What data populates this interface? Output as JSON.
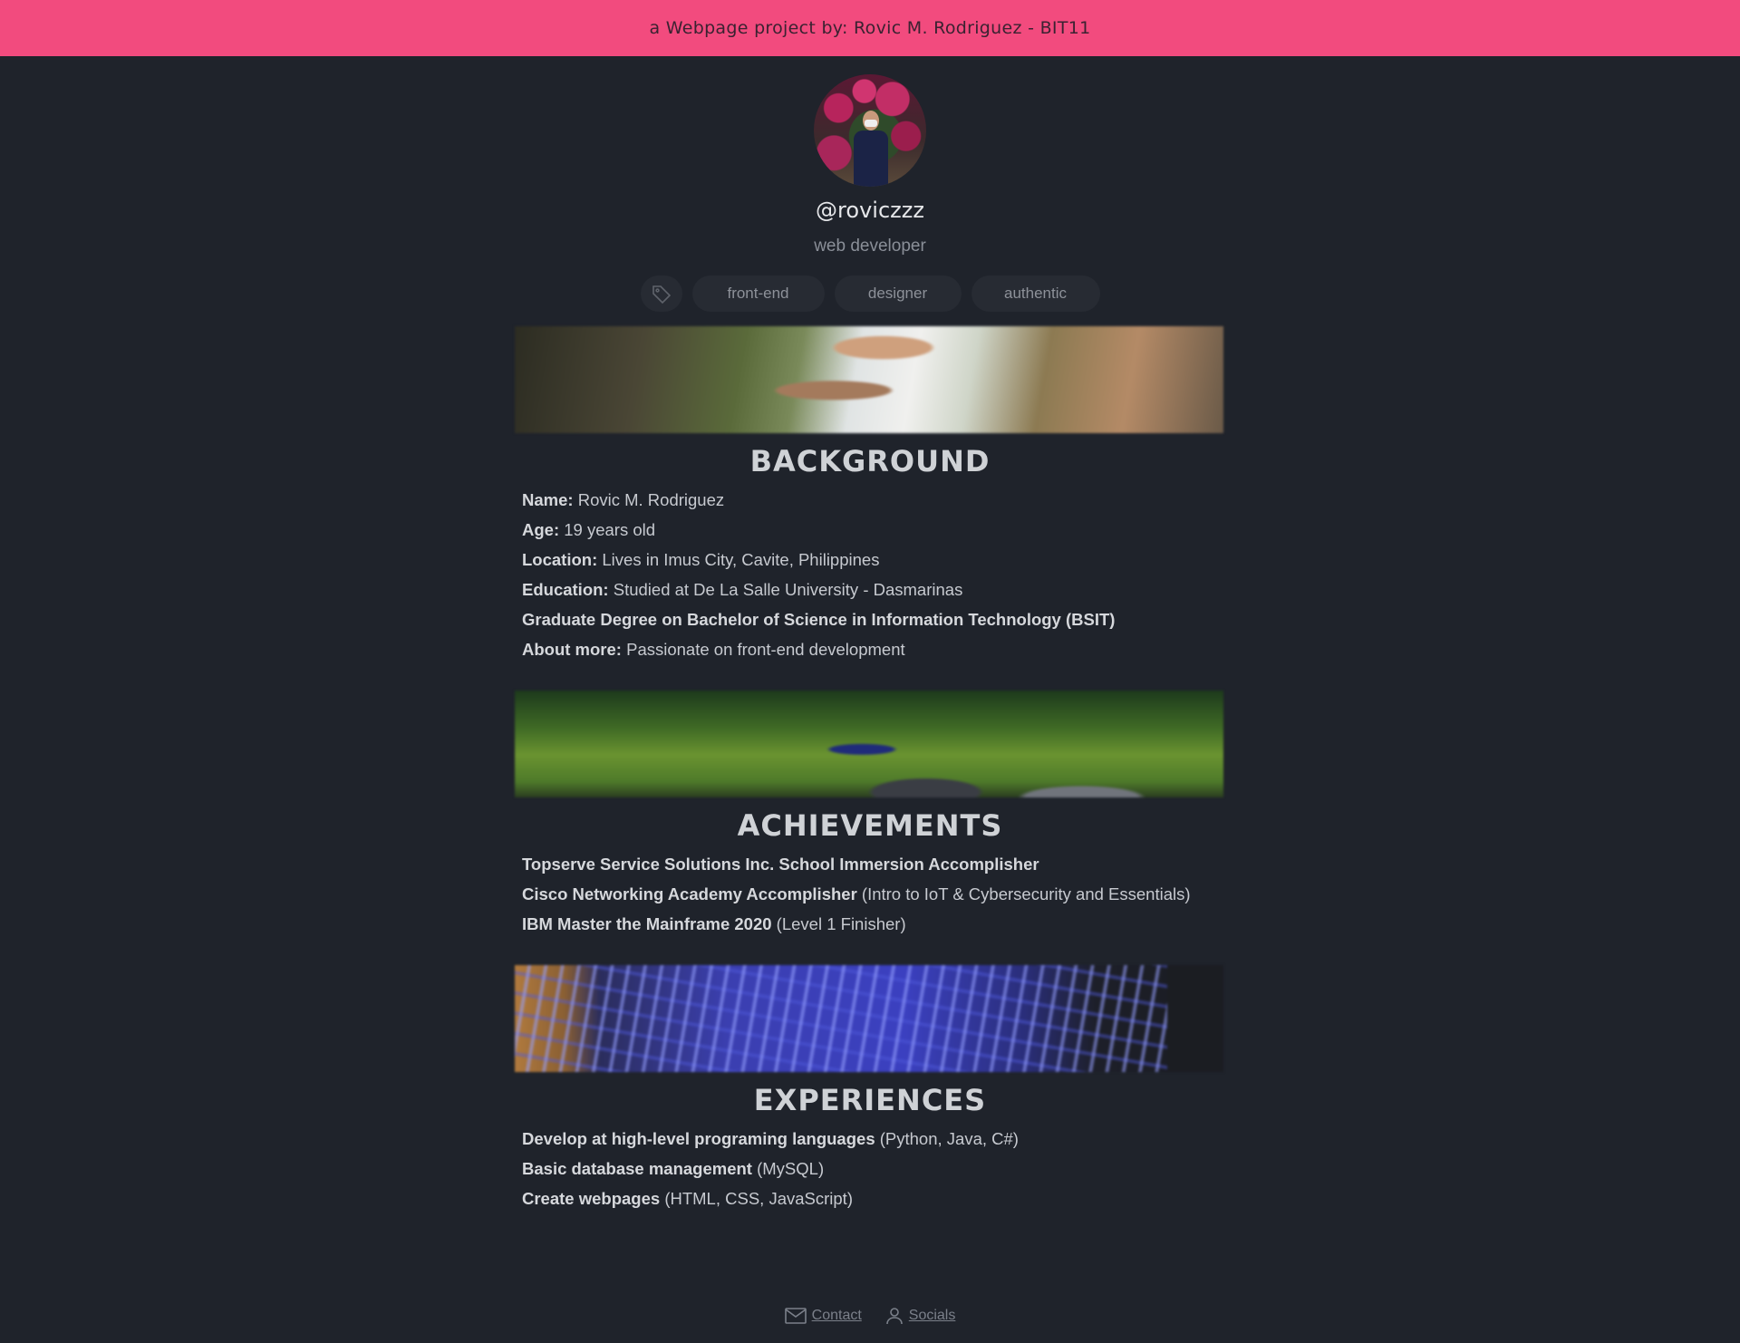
{
  "header": {
    "text": "a Webpage project by: Rovic M. Rodriguez - BIT11"
  },
  "profile": {
    "username": "@roviczzz",
    "role": "web developer",
    "tags": [
      "front-end",
      "designer",
      "authentic"
    ]
  },
  "sections": {
    "background": {
      "title": "BACKGROUND",
      "lines": [
        {
          "label": "Name:",
          "text": " Rovic M. Rodriguez"
        },
        {
          "label": "Age:",
          "text": " 19 years old"
        },
        {
          "label": "Location:",
          "text": " Lives in Imus City, Cavite, Philippines"
        },
        {
          "label": "Education:",
          "text": " Studied at De La Salle University - Dasmarinas"
        },
        {
          "label": "Graduate Degree on Bachelor of Science in Information Technology (BSIT)",
          "text": ""
        },
        {
          "label": "About more:",
          "text": " Passionate on front-end development"
        }
      ]
    },
    "achievements": {
      "title": "ACHIEVEMENTS",
      "lines": [
        {
          "label": "Topserve Service Solutions Inc. School Immersion Accomplisher",
          "text": ""
        },
        {
          "label": "Cisco Networking Academy Accomplisher",
          "text": " (Intro to IoT & Cybersecurity and Essentials)"
        },
        {
          "label": "IBM Master the Mainframe 2020",
          "text": " (Level 1 Finisher)"
        }
      ]
    },
    "experiences": {
      "title": "EXPERIENCES",
      "lines": [
        {
          "label": "Develop at high-level programing languages",
          "text": " (Python, Java, C#)"
        },
        {
          "label": "Basic database management",
          "text": " (MySQL)"
        },
        {
          "label": "Create webpages",
          "text": " (HTML, CSS, JavaScript)"
        }
      ]
    }
  },
  "footer": {
    "contact_label": "Contact",
    "socials_label": "Socials",
    "contact_icon": "mail-icon",
    "socials_icon": "user-icon"
  },
  "colors": {
    "accent": "#f24b7e",
    "background": "#1f232b"
  }
}
